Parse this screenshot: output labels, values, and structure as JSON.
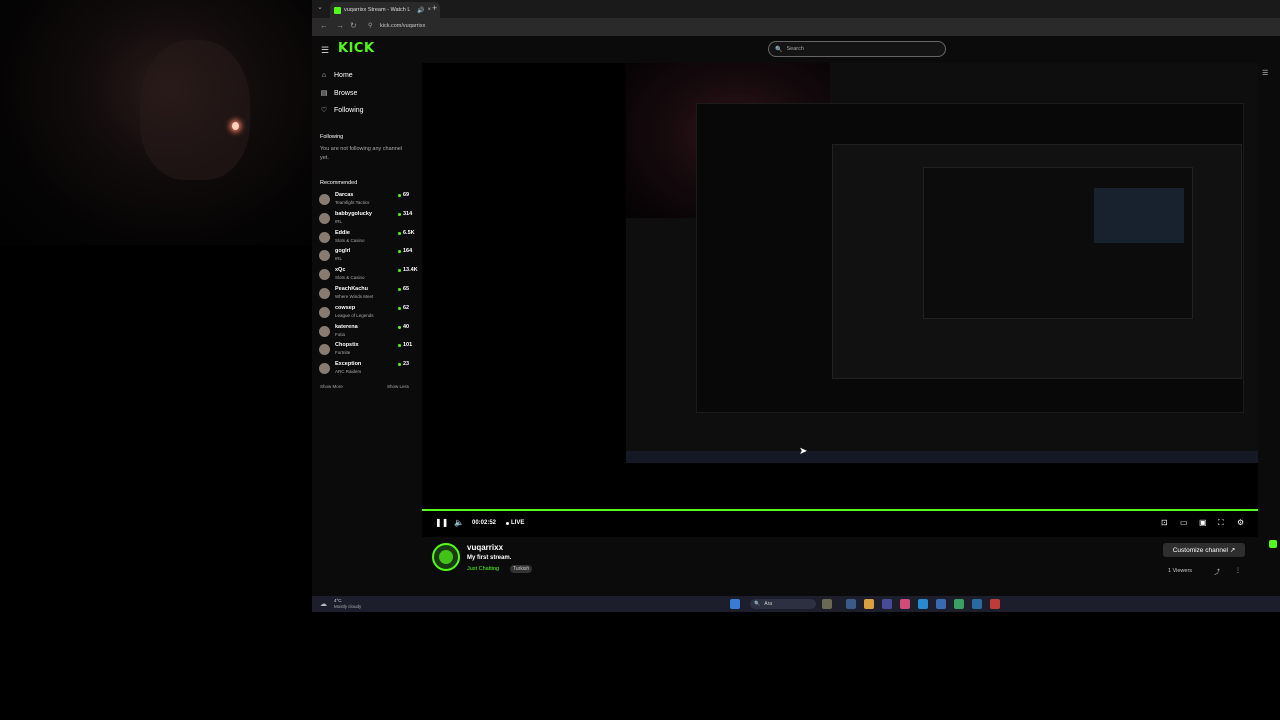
{
  "browser": {
    "tab_title": "vuqarrixx Stream - Watch L",
    "url": "kick.com/vuqarrixx"
  },
  "header": {
    "logo": "KICK",
    "search_placeholder": "Search"
  },
  "sidebar": {
    "nav": [
      {
        "label": "Home",
        "icon": "home-icon"
      },
      {
        "label": "Browse",
        "icon": "browse-icon"
      },
      {
        "label": "Following",
        "icon": "heart-icon"
      }
    ],
    "following_title": "Following",
    "following_empty": "You are not following any channel yet.",
    "recommended_title": "Recommended",
    "recommended": [
      {
        "name": "Darcas",
        "category": "Teamfight Tactics",
        "viewers": "69"
      },
      {
        "name": "babbygolucky",
        "category": "IRL",
        "viewers": "314"
      },
      {
        "name": "Eddie",
        "category": "Slots & Casino",
        "viewers": "6.5K"
      },
      {
        "name": "goglrl",
        "category": "IRL",
        "viewers": "164"
      },
      {
        "name": "xQc",
        "category": "Slots & Casino",
        "viewers": "13.4K"
      },
      {
        "name": "PeachKachu",
        "category": "Where Winds Meet",
        "viewers": "65"
      },
      {
        "name": "cowsep",
        "category": "League of Legends",
        "viewers": "62"
      },
      {
        "name": "katerena",
        "category": "Fotia",
        "viewers": "40"
      },
      {
        "name": "Chopstix",
        "category": "Fortnite",
        "viewers": "101"
      },
      {
        "name": "Exception",
        "category": "ARC Raiders",
        "viewers": "23"
      }
    ],
    "show_more": "Show More",
    "show_less": "Show Less"
  },
  "player": {
    "time": "00:02:52",
    "live": "LIVE"
  },
  "channel": {
    "name": "vuqarrixx",
    "title": "My first stream.",
    "category": "Just Chatting",
    "tag": "Turkish",
    "customize_label": "Customize channel",
    "viewers": "1 Viewers"
  },
  "taskbar": {
    "temp": "4°C",
    "weather": "Mostly cloudy",
    "search": "Ara"
  },
  "colors": {
    "accent": "#53fc18",
    "background": "#0b0b0b"
  }
}
